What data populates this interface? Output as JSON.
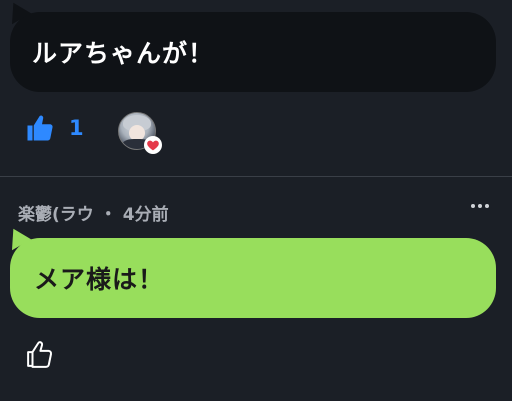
{
  "message1": {
    "text": "ルアちゃんが！",
    "like_count": "1"
  },
  "message2": {
    "author": "楽鬱(ラウ",
    "separator": "・",
    "time": "4分前",
    "text": "メア様は！"
  },
  "colors": {
    "like_blue": "#2e89ff",
    "bubble_dark": "#0f1216",
    "bubble_green": "#98de5c",
    "heart_red": "#e5394a",
    "background": "#1b1f26"
  },
  "icons": {
    "like_filled": "thumbs-up-filled-icon",
    "like_outline": "thumbs-up-outline-icon",
    "reaction_heart": "heart-icon",
    "more": "more-horizontal-icon"
  }
}
